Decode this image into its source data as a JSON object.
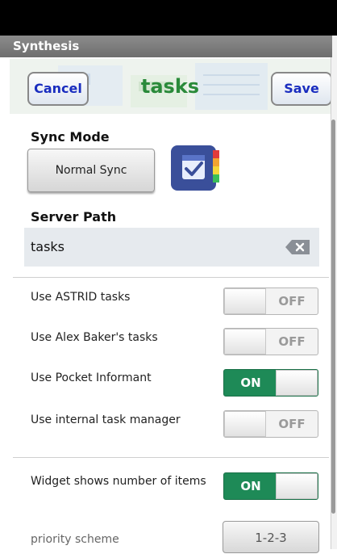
{
  "app": {
    "title": "Synthesis"
  },
  "header": {
    "cancel_label": "Cancel",
    "title": "tasks",
    "save_label": "Save"
  },
  "sync_mode": {
    "label": "Sync Mode",
    "button_label": "Normal Sync",
    "icon": "calendar-check-icon"
  },
  "server_path": {
    "label": "Server Path",
    "value": "tasks",
    "clear_icon": "clear-text-icon"
  },
  "options": [
    {
      "label": "Use ASTRID tasks",
      "state": "OFF"
    },
    {
      "label": "Use Alex Baker's tasks",
      "state": "OFF"
    },
    {
      "label": "Use Pocket Informant",
      "state": "ON"
    },
    {
      "label": "Use internal task manager",
      "state": "OFF"
    }
  ],
  "widget": {
    "label": "Widget shows number of items",
    "state": "ON"
  },
  "priority": {
    "label": "priority scheme",
    "value": "1-2-3"
  },
  "colors": {
    "accent_green": "#1e8a57",
    "title_green": "#2a8a3a",
    "button_blue": "#1a2dbf"
  }
}
